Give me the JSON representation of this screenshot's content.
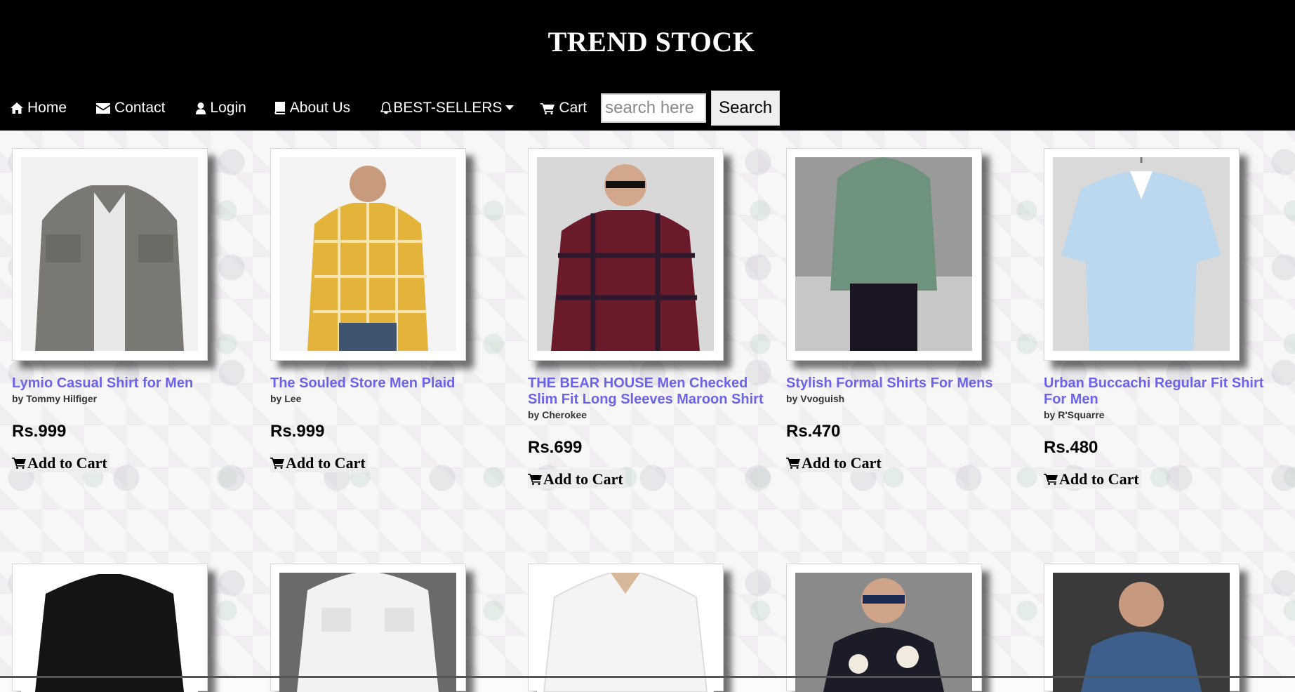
{
  "header": {
    "title": "TREND STOCK"
  },
  "nav": {
    "home": {
      "label": "Home",
      "icon": "home-icon"
    },
    "contact": {
      "label": "Contact",
      "icon": "envelope-icon"
    },
    "login": {
      "label": "Login",
      "icon": "user-icon"
    },
    "about": {
      "label": "About Us",
      "icon": "book-icon"
    },
    "bestsellers": {
      "label": "BEST-SELLERS",
      "icon": "bell-icon"
    },
    "cart": {
      "label": "Cart",
      "icon": "cart-icon"
    },
    "search": {
      "placeholder": "search here",
      "value": "",
      "button_label": "Search"
    }
  },
  "products": [
    {
      "title": "Lymio Casual Shirt for Men",
      "brand": "by Tommy Hilfiger",
      "price": "Rs.999",
      "cta": "Add to Cart",
      "colors": [
        "#7a7873",
        "#e8e8e8"
      ]
    },
    {
      "title": "The Souled Store Men Plaid",
      "brand": "by Lee",
      "price": "Rs.999",
      "cta": "Add to Cart",
      "colors": [
        "#e4b43a",
        "#f4f4f4"
      ]
    },
    {
      "title": "THE BEAR HOUSE Men Checked Slim Fit Long Sleeves Maroon Shirt",
      "brand": "by Cherokee",
      "price": "Rs.699",
      "cta": "Add to Cart",
      "colors": [
        "#6b1a2a",
        "#d8d8d8"
      ]
    },
    {
      "title": "Stylish Formal Shirts For Mens",
      "brand": "by Vvoguish",
      "price": "Rs.470",
      "cta": "Add to Cart",
      "colors": [
        "#6f927c",
        "#9a9a9a"
      ]
    },
    {
      "title": "Urban Buccachi Regular Fit Shirt For Men",
      "brand": "by R'Squarre",
      "price": "Rs.480",
      "cta": "Add to Cart",
      "colors": [
        "#bcd8ee",
        "#d9d9d9"
      ]
    }
  ],
  "products_row2": [
    {
      "colors": [
        "#141414",
        "#ffffff"
      ]
    },
    {
      "colors": [
        "#f2f2f2",
        "#6a6a6a"
      ]
    },
    {
      "colors": [
        "#f4f4f4",
        "#ffffff"
      ]
    },
    {
      "colors": [
        "#1c1c28",
        "#8a8a8a"
      ]
    },
    {
      "colors": [
        "#3d5f8c",
        "#3a3a3a"
      ]
    }
  ]
}
